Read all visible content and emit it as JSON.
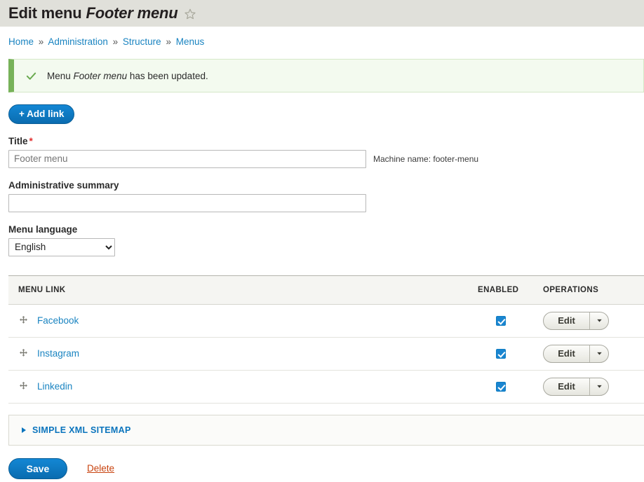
{
  "header": {
    "title_prefix": "Edit menu",
    "title_name": "Footer menu",
    "star_icon": "star-outline-icon"
  },
  "breadcrumb": {
    "separator": "»",
    "items": [
      {
        "label": "Home"
      },
      {
        "label": "Administration"
      },
      {
        "label": "Structure"
      },
      {
        "label": "Menus"
      }
    ]
  },
  "message": {
    "icon": "check-icon",
    "text_before": "Menu",
    "emphasis": "Footer menu",
    "text_after": "has been updated.",
    "accent_color": "#77b259",
    "background_color": "#f3faef"
  },
  "toolbar": {
    "add_link_label": "+ Add link"
  },
  "form": {
    "title": {
      "label": "Title",
      "required_marker": "*",
      "value": "Footer menu",
      "machine_name": "Machine name: footer-menu"
    },
    "summary": {
      "label": "Administrative summary",
      "value": "",
      "placeholder": ""
    },
    "language": {
      "label": "Menu language",
      "selected": "English",
      "options": [
        "English"
      ]
    }
  },
  "table": {
    "columns": [
      "MENU LINK",
      "ENABLED",
      "OPERATIONS"
    ],
    "rows": [
      {
        "drag_icon": "move-icon",
        "label": "Facebook",
        "enabled": true,
        "edit_label": "Edit",
        "toggle_icon": "chevron-down-icon"
      },
      {
        "drag_icon": "move-icon",
        "label": "Instagram",
        "enabled": true,
        "edit_label": "Edit",
        "toggle_icon": "chevron-down-icon"
      },
      {
        "drag_icon": "move-icon",
        "label": "Linkedin",
        "enabled": true,
        "edit_label": "Edit",
        "toggle_icon": "chevron-down-icon"
      }
    ]
  },
  "details": {
    "summary": "SIMPLE XML SITEMAP",
    "marker_icon": "triangle-right-icon",
    "expanded": false
  },
  "actions": {
    "save_label": "Save",
    "delete_label": "Delete",
    "primary_color": "#0d77c0",
    "delete_color": "#c8430f"
  }
}
